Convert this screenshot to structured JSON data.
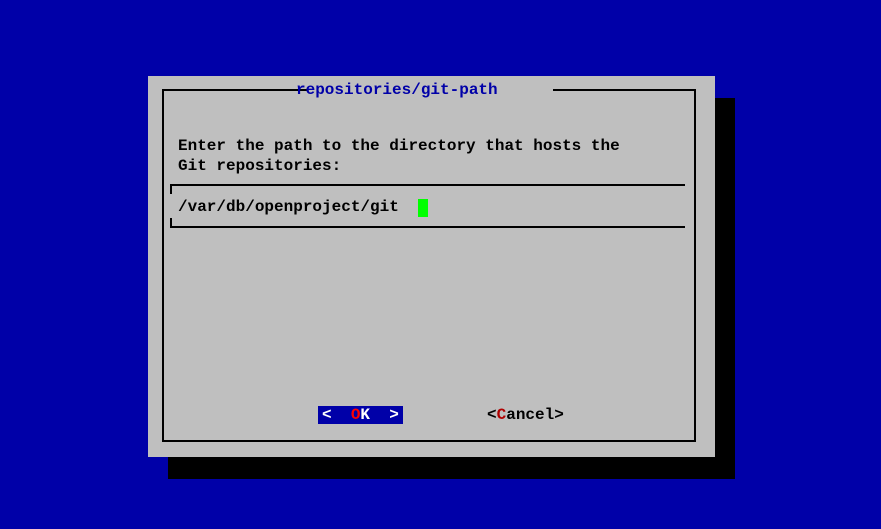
{
  "dialog": {
    "title": "repositories/git-path",
    "prompt": "Enter the path to the directory that hosts the\nGit repositories:",
    "input_value": "/var/db/openproject/git"
  },
  "buttons": {
    "ok_pre": "<  ",
    "ok_hot": "O",
    "ok_post": "K  >",
    "cancel_pre": "<",
    "cancel_hot": "C",
    "cancel_post": "ancel>"
  }
}
